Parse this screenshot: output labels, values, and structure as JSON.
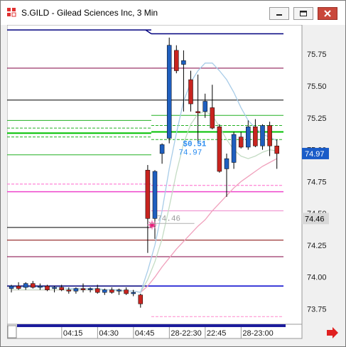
{
  "window": {
    "title": "S.GILD - Gilead Sciences Inc, 3 Min",
    "icon": "app-icon",
    "controls": [
      "minimize-icon",
      "maximize-icon",
      "close-icon"
    ]
  },
  "colors": {
    "up": "#1f5fbf",
    "down": "#c8241f",
    "plot_bg": "#ffffff",
    "text": "#1a1a1a"
  },
  "scroll": {
    "arrow": "red-right-arrow-icon"
  },
  "chart_data": {
    "type": "candlestick",
    "ylim": [
      73.63,
      75.98
    ],
    "y_ticks": [
      73.75,
      74.0,
      74.25,
      74.5,
      74.75,
      75.0,
      75.25,
      75.5,
      75.75
    ],
    "y_tick_labels": [
      "73.75",
      "74.00",
      "74.25",
      "74.50",
      "74.75",
      "75.00",
      "75.25",
      "75.50",
      "75.75"
    ],
    "x_labels": [
      {
        "i": 8.5,
        "label": "04:15"
      },
      {
        "i": 13.5,
        "label": "04:30"
      },
      {
        "i": 18.5,
        "label": "04:45"
      },
      {
        "i": 23.5,
        "label": "28-22:30"
      },
      {
        "i": 28.5,
        "label": "22:45"
      },
      {
        "i": 33.5,
        "label": "28-23:00"
      }
    ],
    "split_index": 19.5,
    "candles": [
      {
        "o": 73.91,
        "h": 73.94,
        "l": 73.88,
        "c": 73.93
      },
      {
        "o": 73.93,
        "h": 73.96,
        "l": 73.9,
        "c": 73.91
      },
      {
        "o": 73.92,
        "h": 73.96,
        "l": 73.9,
        "c": 73.95
      },
      {
        "o": 73.95,
        "h": 73.97,
        "l": 73.91,
        "c": 73.92
      },
      {
        "o": 73.92,
        "h": 73.95,
        "l": 73.9,
        "c": 73.93
      },
      {
        "o": 73.93,
        "h": 73.94,
        "l": 73.89,
        "c": 73.9
      },
      {
        "o": 73.91,
        "h": 73.93,
        "l": 73.88,
        "c": 73.92
      },
      {
        "o": 73.92,
        "h": 73.94,
        "l": 73.89,
        "c": 73.9
      },
      {
        "o": 73.9,
        "h": 73.92,
        "l": 73.87,
        "c": 73.89
      },
      {
        "o": 73.89,
        "h": 73.92,
        "l": 73.87,
        "c": 73.91
      },
      {
        "o": 73.91,
        "h": 73.95,
        "l": 73.88,
        "c": 73.9
      },
      {
        "o": 73.9,
        "h": 73.92,
        "l": 73.88,
        "c": 73.91
      },
      {
        "o": 73.91,
        "h": 73.94,
        "l": 73.87,
        "c": 73.88
      },
      {
        "o": 73.88,
        "h": 73.91,
        "l": 73.86,
        "c": 73.9
      },
      {
        "o": 73.9,
        "h": 73.92,
        "l": 73.87,
        "c": 73.88
      },
      {
        "o": 73.89,
        "h": 73.91,
        "l": 73.86,
        "c": 73.9
      },
      {
        "o": 73.9,
        "h": 73.92,
        "l": 73.86,
        "c": 73.87
      },
      {
        "o": 73.87,
        "h": 73.9,
        "l": 73.85,
        "c": 73.88
      },
      {
        "o": 73.86,
        "h": 73.87,
        "l": 73.76,
        "c": 73.79
      },
      {
        "o": 74.84,
        "h": 74.88,
        "l": 74.19,
        "c": 74.46
      },
      {
        "o": 74.46,
        "h": 74.84,
        "l": 74.3,
        "c": 74.83
      },
      {
        "o": 74.97,
        "h": 75.05,
        "l": 74.89,
        "c": 75.04
      },
      {
        "o": 75.09,
        "h": 75.88,
        "l": 75.05,
        "c": 75.82
      },
      {
        "o": 75.78,
        "h": 75.82,
        "l": 75.6,
        "c": 75.62
      },
      {
        "o": 75.67,
        "h": 75.78,
        "l": 75.3,
        "c": 75.7
      },
      {
        "o": 75.55,
        "h": 75.62,
        "l": 75.3,
        "c": 75.36
      },
      {
        "o": 75.3,
        "h": 75.59,
        "l": 75.05,
        "c": 75.29
      },
      {
        "o": 75.3,
        "h": 75.44,
        "l": 75.25,
        "c": 75.38
      },
      {
        "o": 75.33,
        "h": 75.51,
        "l": 75.16,
        "c": 75.17
      },
      {
        "o": 75.18,
        "h": 75.2,
        "l": 74.82,
        "c": 74.83
      },
      {
        "o": 74.85,
        "h": 74.97,
        "l": 74.63,
        "c": 74.93
      },
      {
        "o": 74.9,
        "h": 75.14,
        "l": 74.85,
        "c": 75.12
      },
      {
        "o": 75.1,
        "h": 75.14,
        "l": 75.01,
        "c": 75.02
      },
      {
        "o": 75.02,
        "h": 75.23,
        "l": 75.0,
        "c": 75.18
      },
      {
        "o": 75.18,
        "h": 75.24,
        "l": 75.02,
        "c": 75.03
      },
      {
        "o": 75.03,
        "h": 75.2,
        "l": 75.0,
        "c": 75.19
      },
      {
        "o": 75.19,
        "h": 75.22,
        "l": 74.95,
        "c": 75.03
      },
      {
        "o": 75.03,
        "h": 75.08,
        "l": 74.85,
        "c": 74.97
      }
    ],
    "fast_ma": [
      73.92,
      73.92,
      73.92,
      73.92,
      73.92,
      73.92,
      73.92,
      73.92,
      73.91,
      73.91,
      73.91,
      73.91,
      73.91,
      73.9,
      73.9,
      73.9,
      73.89,
      73.89,
      73.88,
      74.05,
      74.25,
      74.52,
      74.85,
      75.13,
      75.38,
      75.53,
      75.62,
      75.68,
      75.68,
      75.62,
      75.55,
      75.45,
      75.33,
      75.23,
      75.17,
      75.12,
      75.1,
      75.07
    ],
    "slow_ma": [
      73.9,
      73.9,
      73.9,
      73.9,
      73.9,
      73.9,
      73.9,
      73.9,
      73.9,
      73.9,
      73.9,
      73.9,
      73.9,
      73.9,
      73.9,
      73.89,
      73.89,
      73.89,
      73.88,
      73.98,
      74.12,
      74.3,
      74.55,
      74.82,
      75.05,
      75.2,
      75.28,
      75.3,
      75.27,
      75.18,
      75.08,
      75.0,
      74.95,
      74.93,
      74.95,
      74.98,
      75.0,
      74.99
    ],
    "pink_ma": [
      73.9,
      73.9,
      73.9,
      73.9,
      73.9,
      73.9,
      73.9,
      73.9,
      73.9,
      73.9,
      73.9,
      73.9,
      73.9,
      73.9,
      73.9,
      73.9,
      73.89,
      73.89,
      73.88,
      73.93,
      74.0,
      74.08,
      74.15,
      74.22,
      74.28,
      74.34,
      74.4,
      74.45,
      74.52,
      74.58,
      74.64,
      74.7,
      74.75,
      74.79,
      74.83,
      74.87,
      74.9,
      74.93
    ],
    "levels_right": [
      {
        "y": 75.91,
        "color": "#00007f",
        "w": 1.5
      },
      {
        "y": 75.64,
        "color": "#800040",
        "w": 1
      },
      {
        "y": 75.39,
        "color": "#000000",
        "w": 1
      },
      {
        "y": 75.27,
        "color": "#22b022",
        "w": 1
      },
      {
        "y": 75.19,
        "color": "#22b022",
        "w": 1,
        "dash": "4,2"
      },
      {
        "y": 75.14,
        "color": "#00c000",
        "w": 2
      },
      {
        "y": 75.08,
        "color": "#22b022",
        "w": 1,
        "dash": "4,2"
      },
      {
        "y": 74.72,
        "color": "#ff66cc",
        "w": 1,
        "dash": "4,2"
      },
      {
        "y": 74.67,
        "color": "#ee44cc",
        "w": 1.5
      },
      {
        "y": 74.52,
        "color": "#ee88cc",
        "w": 1
      },
      {
        "y": 74.29,
        "color": "#800000",
        "w": 1
      },
      {
        "y": 74.16,
        "color": "#800040",
        "w": 1
      },
      {
        "y": 73.93,
        "color": "#0000cc",
        "w": 1.5
      },
      {
        "y": 73.69,
        "color": "#ff88cc",
        "w": 1,
        "dash": "4,2"
      }
    ],
    "levels_left": [
      {
        "y": 75.94,
        "color": "#00007f",
        "w": 1.5
      },
      {
        "y": 75.64,
        "color": "#800040",
        "w": 1
      },
      {
        "y": 75.39,
        "color": "#000000",
        "w": 1
      },
      {
        "y": 75.23,
        "color": "#22b022",
        "w": 1
      },
      {
        "y": 75.17,
        "color": "#22b022",
        "w": 1,
        "dash": "4,2"
      },
      {
        "y": 75.13,
        "color": "#00c000",
        "w": 2
      },
      {
        "y": 75.1,
        "color": "#22b022",
        "w": 1,
        "dash": "4,2"
      },
      {
        "y": 74.96,
        "color": "#22b022",
        "w": 1
      },
      {
        "y": 74.73,
        "color": "#ff66cc",
        "w": 1,
        "dash": "4,2"
      },
      {
        "y": 74.67,
        "color": "#ee44cc",
        "w": 1.5
      },
      {
        "y": 74.39,
        "color": "#000000",
        "w": 1
      },
      {
        "y": 74.29,
        "color": "#800000",
        "w": 1
      },
      {
        "y": 74.16,
        "color": "#800040",
        "w": 1
      },
      {
        "y": 73.93,
        "color": "#00007f",
        "w": 1.5
      }
    ],
    "annotations": {
      "change": "$0.51",
      "last": "74.97",
      "ref": "74.46",
      "change_y": 75.05,
      "ref_y": 74.46,
      "marker_icon": "pink-star-icon"
    },
    "price_tags": [
      {
        "value": "74.97",
        "y": 74.97,
        "bg": "#1a5cc8",
        "fg": "#ffffff"
      },
      {
        "value": "74.46",
        "y": 74.46,
        "bg": "#d8d8d8",
        "fg": "#000000"
      }
    ]
  }
}
